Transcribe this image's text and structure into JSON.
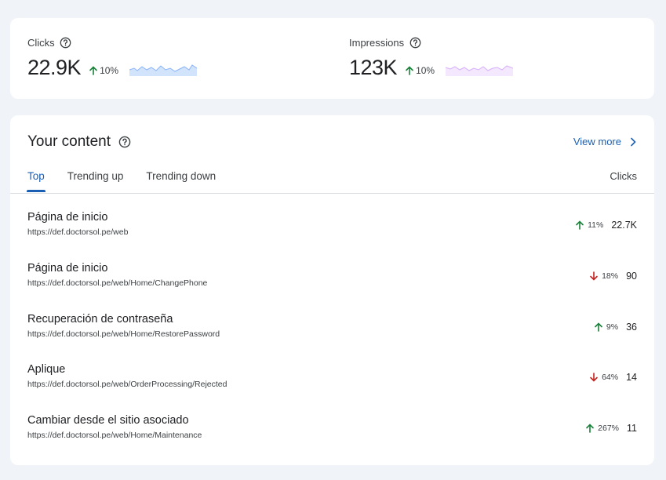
{
  "metrics": {
    "clicks": {
      "label": "Clicks",
      "value": "22.9K",
      "trend": "10%",
      "trend_dir": "up",
      "spark_color": "#aecbfa"
    },
    "impressions": {
      "label": "Impressions",
      "value": "123K",
      "trend": "10%",
      "trend_dir": "up",
      "spark_color": "#e9d7fb"
    }
  },
  "content": {
    "title": "Your content",
    "view_more": "View more",
    "tabs": [
      {
        "label": "Top",
        "active": true
      },
      {
        "label": "Trending up",
        "active": false
      },
      {
        "label": "Trending down",
        "active": false
      }
    ],
    "column_header": "Clicks",
    "rows": [
      {
        "title": "Página de inicio",
        "url": "https://def.doctorsol.pe/web",
        "trend": "11%",
        "trend_dir": "up",
        "clicks": "22.7K"
      },
      {
        "title": "Página de inicio",
        "url": "https://def.doctorsol.pe/web/Home/ChangePhone",
        "trend": "18%",
        "trend_dir": "down",
        "clicks": "90"
      },
      {
        "title": "Recuperación de contraseña",
        "url": "https://def.doctorsol.pe/web/Home/RestorePassword",
        "trend": "9%",
        "trend_dir": "up",
        "clicks": "36"
      },
      {
        "title": "Aplique",
        "url": "https://def.doctorsol.pe/web/OrderProcessing/Rejected",
        "trend": "64%",
        "trend_dir": "down",
        "clicks": "14"
      },
      {
        "title": "Cambiar desde el sitio asociado",
        "url": "https://def.doctorsol.pe/web/Home/Maintenance",
        "trend": "267%",
        "trend_dir": "up",
        "clicks": "11"
      }
    ]
  },
  "colors": {
    "up": "#188038",
    "down": "#c5221f",
    "accent": "#1a5fb4"
  }
}
